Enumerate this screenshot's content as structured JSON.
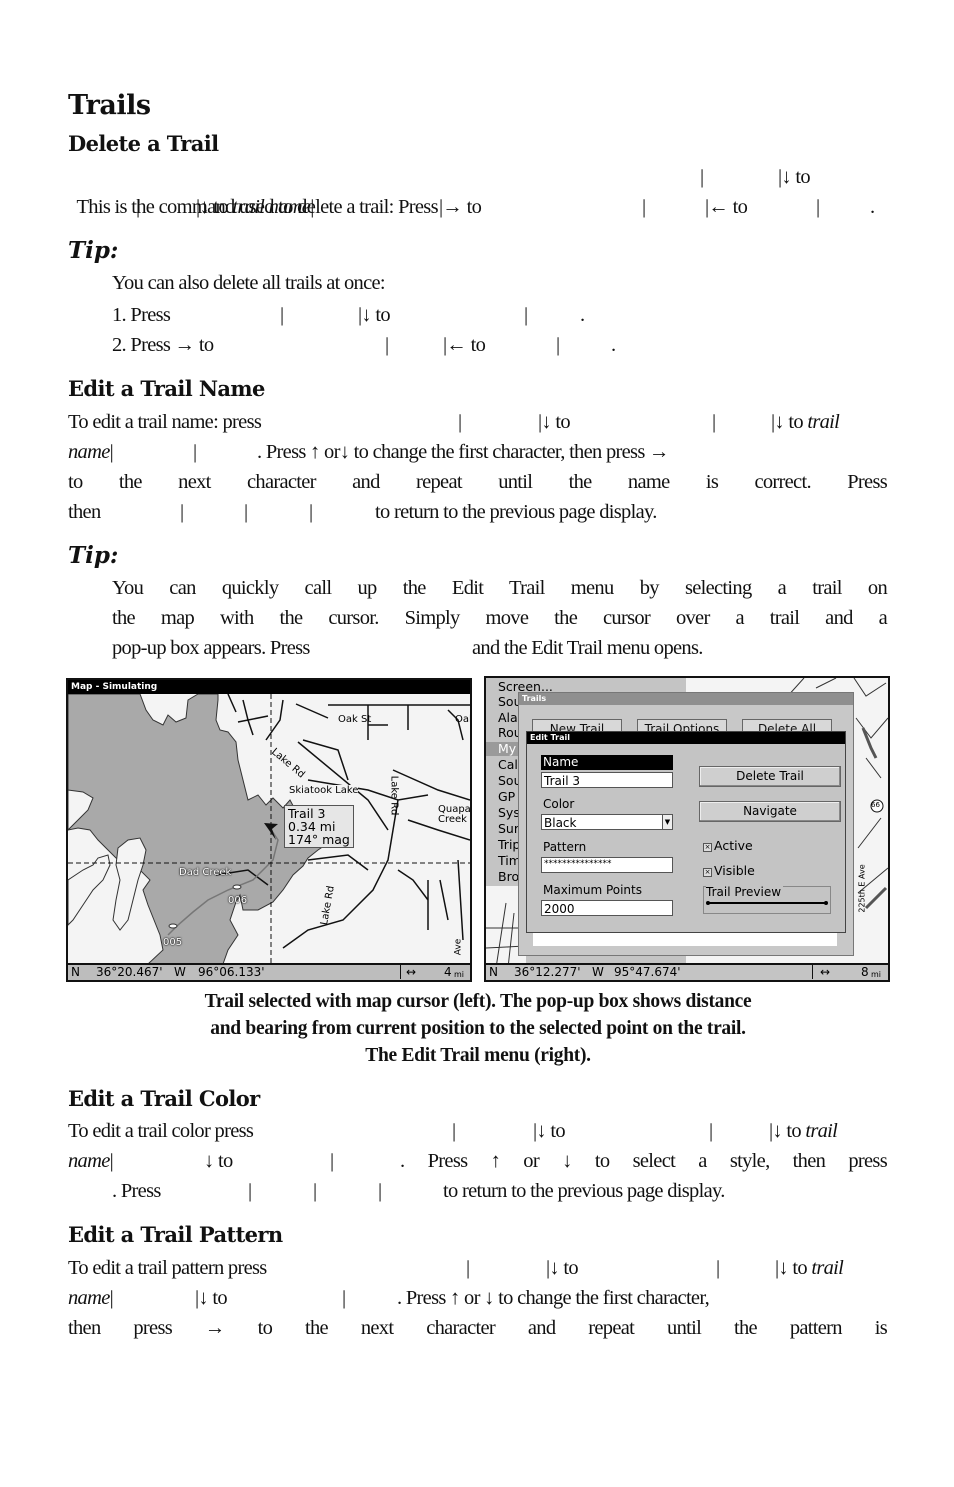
{
  "page": {
    "title": "Trails",
    "sections": {
      "delete": {
        "heading": "Delete a Trail",
        "lines": [
          {
            "a": "This is the command used to delete a trail: Press",
            "b": "|",
            "c": "|↓ to"
          },
          {
            "a": "|",
            "b": "|↓ to ",
            "i": "trail name",
            "c": "|",
            "d": "|→ to",
            "e": "|",
            "f": "|← to",
            "g": "|",
            "h": "."
          }
        ]
      },
      "tip1": {
        "label": "Tip:",
        "intro": "You can also delete all trails at once:",
        "step1": {
          "a": "1. Press",
          "b": "|",
          "c": "|↓ to",
          "d": "|",
          "e": "."
        },
        "step2": {
          "a": "2. Press → to",
          "b": "|",
          "c": "|← to",
          "d": "|",
          "e": "."
        }
      },
      "edit_name": {
        "heading": "Edit a Trail Name",
        "line1": {
          "a": "To edit a trail name: press",
          "b": "|",
          "c": "|↓ to",
          "d": "|",
          "e": "|↓ to ",
          "i": "trail"
        },
        "line2": {
          "i": "name",
          "a": "|",
          "b": "|",
          "c": ". Press ↑ or↓ to change the first character, then press →"
        },
        "line3": "to the next character and repeat until the name is correct. Press",
        "line4": {
          "a": "then",
          "b": "|",
          "c": "|",
          "d": "|",
          "e": "to return to the previous page display."
        }
      },
      "tip2": {
        "label": "Tip:",
        "lines": [
          "You can quickly call up the Edit Trail menu by selecting a trail on",
          "the map with the cursor. Simply move the cursor over a trail and a",
          {
            "a": "pop-up box appears. Press",
            "b": "and the Edit Trail menu opens."
          }
        ]
      },
      "edit_color": {
        "heading": "Edit a Trail Color",
        "line1": {
          "a": "To edit a trail color press",
          "b": "|",
          "c": "|↓ to",
          "d": "|",
          "e": "|↓ to ",
          "i": "trail"
        },
        "line2": {
          "i": "name",
          "a": "|",
          "b": "↓ to",
          "c": "|",
          "d": ". Press ↑ or ↓ to select a style, then press"
        },
        "line3": {
          "a": ". Press",
          "b": "|",
          "c": "|",
          "d": "|",
          "e": "to return to the previous page display."
        }
      },
      "edit_pattern": {
        "heading": "Edit a Trail Pattern",
        "line1": {
          "a": "To edit a trail pattern press",
          "b": "|",
          "c": "|↓ to",
          "d": "|",
          "e": "|↓ to ",
          "i": "trail"
        },
        "line2": {
          "i": "name",
          "a": "|",
          "b": "|↓ to",
          "c": "|",
          "d": ". Press ↑ or ↓ to change the first character,"
        },
        "line3": "then press → to the next character and repeat until the pattern is"
      }
    },
    "caption": [
      "Trail selected with map cursor (left). The pop-up box shows distance",
      "and bearing from current position to the selected point on the trail.",
      "The Edit Trail menu (right)."
    ]
  },
  "left_screen": {
    "title": "Map - Simulating",
    "popup": {
      "name": "Trail 3",
      "distance": "0.34 mi",
      "bearing": "174° mag"
    },
    "labels": {
      "oak_st": "Oak St",
      "oak_st2": "Oal",
      "lake_rd": "Lake Rd",
      "skiatook": "Skiatook Lake",
      "lake_rd2": "Lake Rd",
      "quapaw": "Quapa",
      "creek": "Creek",
      "dad_creek": "Dad Creek",
      "wp006": "006",
      "wp005": "005",
      "lake_rd3": "Lake Rd",
      "ave": "Ave"
    },
    "status": {
      "lat_hemi": "N",
      "lat": "36°20.467'",
      "lon_hemi": "W",
      "lon": "96°06.133'",
      "zoom_icon": "↔",
      "zoom": "4",
      "zoom_unit": "mi"
    },
    "colors": {
      "water": "#a9a9a9",
      "land": "#f4f4f4"
    }
  },
  "right_screen": {
    "menu": [
      "Screen...",
      "Sou",
      "Ala",
      "Rou",
      "My",
      "Cal",
      "Sou",
      "GP",
      "Sys",
      "Sur",
      "Trip",
      "Tim",
      "Bro"
    ],
    "menu_selected_index": 4,
    "trails_window": {
      "title": "Trails",
      "tabs": [
        "New Trail",
        "Trail Options",
        "Delete All"
      ]
    },
    "edit_trail": {
      "title": "Edit Trail",
      "name_label": "Name",
      "name_value": "Trail 3",
      "color_label": "Color",
      "color_value": "Black",
      "pattern_label": "Pattern",
      "pattern_value": "***************",
      "max_points_label": "Maximum Points",
      "max_points_value": "2000",
      "delete_button": "Delete Trail",
      "navigate_button": "Navigate",
      "active_label": "Active",
      "active_checked": true,
      "visible_label": "Visible",
      "visible_checked": true,
      "preview_label": "Trail Preview",
      "check_glyph": "×"
    },
    "map_labels": {
      "route": "66",
      "road": "225th E Ave"
    },
    "status": {
      "lat_hemi": "N",
      "lat": "36°12.277'",
      "lon_hemi": "W",
      "lon": "95°47.674'",
      "zoom_icon": "↔",
      "zoom": "8",
      "zoom_unit": "mi"
    }
  }
}
